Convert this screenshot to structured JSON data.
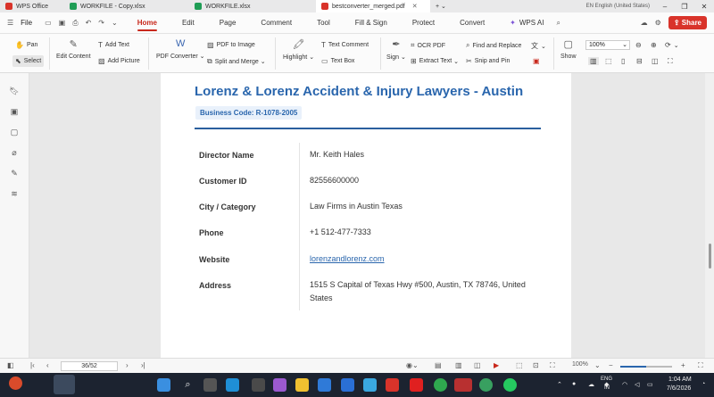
{
  "tabs": [
    {
      "label": "WPS Office",
      "color": "#d9332a"
    },
    {
      "label": "WORKFILE - Copy.xlsx",
      "color": "#1f9d55"
    },
    {
      "label": "WORKFILE.xlsx",
      "color": "#1f9d55"
    },
    {
      "label": "bestconverter_merged.pdf",
      "color": "#d9332a",
      "active": true
    }
  ],
  "lang_notice": "EN English (United States)",
  "menu": {
    "file": "File",
    "items": [
      "Home",
      "Edit",
      "Page",
      "Comment",
      "Tool",
      "Fill & Sign",
      "Protect",
      "Convert"
    ],
    "wps_ai": "WPS AI",
    "share": "Share"
  },
  "ribbon": {
    "pan": "Pan",
    "select": "Select",
    "edit_content": "Edit Content",
    "add_text": "Add Text",
    "add_picture": "Add Picture",
    "pdf_converter": "PDF Converter",
    "pdf_to_image": "PDF to Image",
    "split_merge": "Split and Merge",
    "highlight": "Highlight",
    "text_comment": "Text Comment",
    "text_box": "Text Box",
    "sign": "Sign",
    "ocr_pdf": "OCR PDF",
    "extract_text": "Extract Text",
    "find_replace": "Find and Replace",
    "snip_pin": "Snip and Pin",
    "show": "Show",
    "zoom": "100%"
  },
  "document": {
    "title": "Lorenz & Lorenz Accident & Injury Lawyers - Austin",
    "business_code": "Business Code: R-1078-2005",
    "rows": [
      {
        "label": "Director Name",
        "value": "Mr. Keith Hales"
      },
      {
        "label": "Customer ID",
        "value": "82556600000"
      },
      {
        "label": "City / Category",
        "value": "Law Firms in Austin Texas"
      },
      {
        "label": "Phone",
        "value": "+1 512-477-7333"
      },
      {
        "label": "Website",
        "value": "lorenzandlorenz.com"
      },
      {
        "label": "Address",
        "value": "1515 S Capital of Texas Hwy #500, Austin, TX 78746, United States"
      }
    ]
  },
  "status": {
    "page": "36/52",
    "zoom": "100%",
    "zoom_level": 0.5
  },
  "taskbar": {
    "time": "1:04 AM",
    "date": "7/6/2026",
    "lang": "ENG",
    "region": "IN"
  },
  "colors": {
    "accent": "#c8281c",
    "link": "#2a66ad",
    "taskbar": "#1c2330"
  }
}
